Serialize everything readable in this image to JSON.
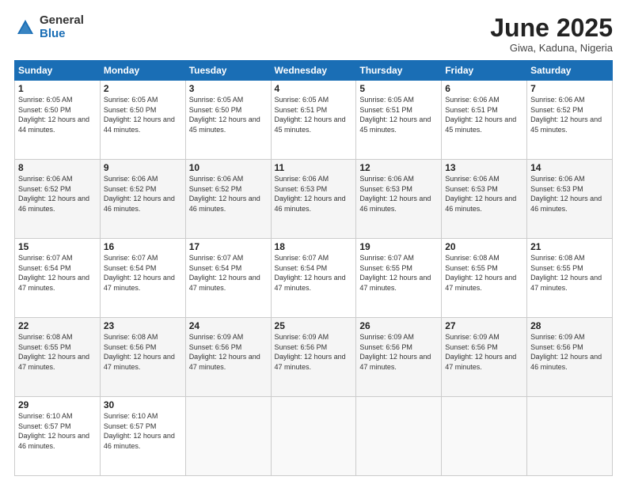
{
  "logo": {
    "general": "General",
    "blue": "Blue"
  },
  "title": "June 2025",
  "location": "Giwa, Kaduna, Nigeria",
  "days_header": [
    "Sunday",
    "Monday",
    "Tuesday",
    "Wednesday",
    "Thursday",
    "Friday",
    "Saturday"
  ],
  "weeks": [
    [
      {
        "day": "1",
        "sunrise": "6:05 AM",
        "sunset": "6:50 PM",
        "daylight": "12 hours and 44 minutes."
      },
      {
        "day": "2",
        "sunrise": "6:05 AM",
        "sunset": "6:50 PM",
        "daylight": "12 hours and 44 minutes."
      },
      {
        "day": "3",
        "sunrise": "6:05 AM",
        "sunset": "6:50 PM",
        "daylight": "12 hours and 45 minutes."
      },
      {
        "day": "4",
        "sunrise": "6:05 AM",
        "sunset": "6:51 PM",
        "daylight": "12 hours and 45 minutes."
      },
      {
        "day": "5",
        "sunrise": "6:05 AM",
        "sunset": "6:51 PM",
        "daylight": "12 hours and 45 minutes."
      },
      {
        "day": "6",
        "sunrise": "6:06 AM",
        "sunset": "6:51 PM",
        "daylight": "12 hours and 45 minutes."
      },
      {
        "day": "7",
        "sunrise": "6:06 AM",
        "sunset": "6:52 PM",
        "daylight": "12 hours and 45 minutes."
      }
    ],
    [
      {
        "day": "8",
        "sunrise": "6:06 AM",
        "sunset": "6:52 PM",
        "daylight": "12 hours and 46 minutes."
      },
      {
        "day": "9",
        "sunrise": "6:06 AM",
        "sunset": "6:52 PM",
        "daylight": "12 hours and 46 minutes."
      },
      {
        "day": "10",
        "sunrise": "6:06 AM",
        "sunset": "6:52 PM",
        "daylight": "12 hours and 46 minutes."
      },
      {
        "day": "11",
        "sunrise": "6:06 AM",
        "sunset": "6:53 PM",
        "daylight": "12 hours and 46 minutes."
      },
      {
        "day": "12",
        "sunrise": "6:06 AM",
        "sunset": "6:53 PM",
        "daylight": "12 hours and 46 minutes."
      },
      {
        "day": "13",
        "sunrise": "6:06 AM",
        "sunset": "6:53 PM",
        "daylight": "12 hours and 46 minutes."
      },
      {
        "day": "14",
        "sunrise": "6:06 AM",
        "sunset": "6:53 PM",
        "daylight": "12 hours and 46 minutes."
      }
    ],
    [
      {
        "day": "15",
        "sunrise": "6:07 AM",
        "sunset": "6:54 PM",
        "daylight": "12 hours and 47 minutes."
      },
      {
        "day": "16",
        "sunrise": "6:07 AM",
        "sunset": "6:54 PM",
        "daylight": "12 hours and 47 minutes."
      },
      {
        "day": "17",
        "sunrise": "6:07 AM",
        "sunset": "6:54 PM",
        "daylight": "12 hours and 47 minutes."
      },
      {
        "day": "18",
        "sunrise": "6:07 AM",
        "sunset": "6:54 PM",
        "daylight": "12 hours and 47 minutes."
      },
      {
        "day": "19",
        "sunrise": "6:07 AM",
        "sunset": "6:55 PM",
        "daylight": "12 hours and 47 minutes."
      },
      {
        "day": "20",
        "sunrise": "6:08 AM",
        "sunset": "6:55 PM",
        "daylight": "12 hours and 47 minutes."
      },
      {
        "day": "21",
        "sunrise": "6:08 AM",
        "sunset": "6:55 PM",
        "daylight": "12 hours and 47 minutes."
      }
    ],
    [
      {
        "day": "22",
        "sunrise": "6:08 AM",
        "sunset": "6:55 PM",
        "daylight": "12 hours and 47 minutes."
      },
      {
        "day": "23",
        "sunrise": "6:08 AM",
        "sunset": "6:56 PM",
        "daylight": "12 hours and 47 minutes."
      },
      {
        "day": "24",
        "sunrise": "6:09 AM",
        "sunset": "6:56 PM",
        "daylight": "12 hours and 47 minutes."
      },
      {
        "day": "25",
        "sunrise": "6:09 AM",
        "sunset": "6:56 PM",
        "daylight": "12 hours and 47 minutes."
      },
      {
        "day": "26",
        "sunrise": "6:09 AM",
        "sunset": "6:56 PM",
        "daylight": "12 hours and 47 minutes."
      },
      {
        "day": "27",
        "sunrise": "6:09 AM",
        "sunset": "6:56 PM",
        "daylight": "12 hours and 47 minutes."
      },
      {
        "day": "28",
        "sunrise": "6:09 AM",
        "sunset": "6:56 PM",
        "daylight": "12 hours and 46 minutes."
      }
    ],
    [
      {
        "day": "29",
        "sunrise": "6:10 AM",
        "sunset": "6:57 PM",
        "daylight": "12 hours and 46 minutes."
      },
      {
        "day": "30",
        "sunrise": "6:10 AM",
        "sunset": "6:57 PM",
        "daylight": "12 hours and 46 minutes."
      },
      null,
      null,
      null,
      null,
      null
    ]
  ],
  "labels": {
    "sunrise": "Sunrise:",
    "sunset": "Sunset:",
    "daylight": "Daylight:"
  }
}
